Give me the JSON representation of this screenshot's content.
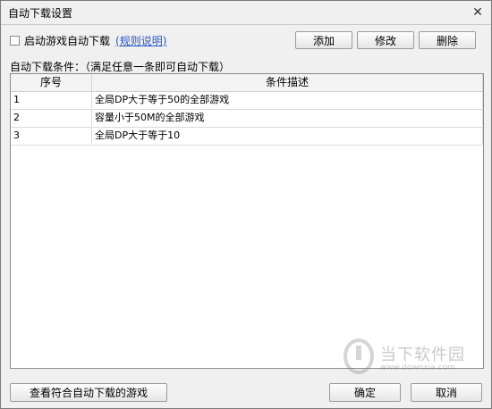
{
  "window": {
    "title": "自动下载设置",
    "close_glyph": "✕"
  },
  "options": {
    "auto_download_checkbox_label": "启动游戏自动下载",
    "rules_link": "(规则说明)",
    "auto_download_checked": false
  },
  "actions": {
    "add": "添加",
    "edit": "修改",
    "delete": "删除"
  },
  "conditions_label": "自动下载条件：（满足任意一条即可自动下载）",
  "table": {
    "columns": [
      "序号",
      "条件描述"
    ],
    "rows": [
      {
        "index": "1",
        "desc": "全局DP大于等于50的全部游戏"
      },
      {
        "index": "2",
        "desc": "容量小于50M的全部游戏"
      },
      {
        "index": "3",
        "desc": "全局DP大于等于10"
      }
    ]
  },
  "footer": {
    "view_matching": "查看符合自动下载的游戏",
    "ok": "确定",
    "cancel": "取消"
  },
  "watermark": {
    "text": "当下软件园",
    "url": "www.downxia.com"
  }
}
